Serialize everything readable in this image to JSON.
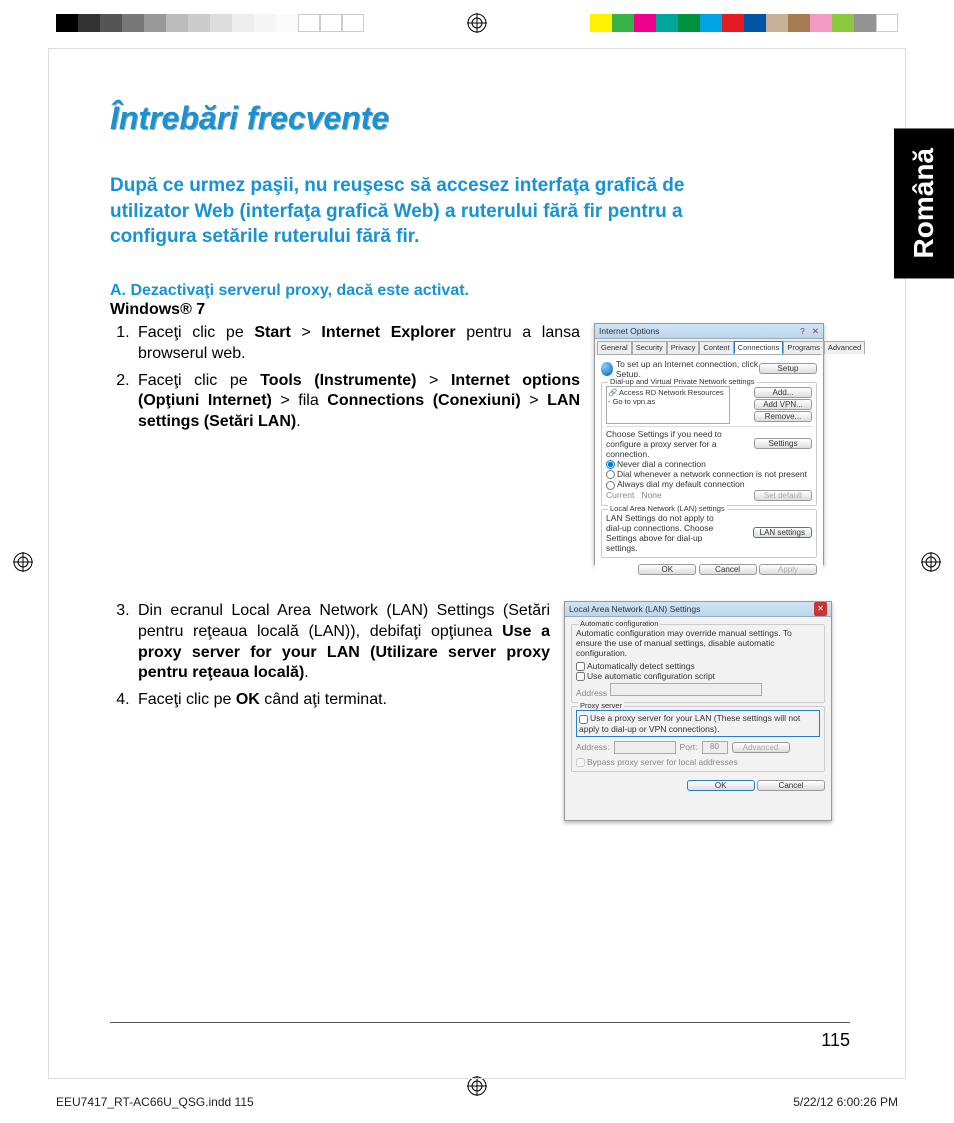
{
  "language_tab": "Română",
  "title": "Întrebări frecvente",
  "question": "După ce urmez paşii, nu reuşesc să accesez interfaţa grafică de utilizator Web (interfaţa grafică Web) a ruterului fără fir pentru a configura setările ruterului fără fir.",
  "sectionA": "A. Dezactivaţi serverul proxy, dacă este activat.",
  "os": "Windows® 7",
  "step1_pre": "Faceţi clic pe ",
  "step1_b1": "Start",
  "step1_mid": " > ",
  "step1_b2": "Internet Explorer",
  "step1_post": " pentru a lansa browserul web.",
  "step2_pre": "Faceţi clic pe ",
  "step2_b1": "Tools (Instrumente)",
  "step2_mid1": " > ",
  "step2_b2": "Internet options (Opţiuni Internet)",
  "step2_mid2": " > fila ",
  "step2_b3": "Connections (Conexiuni)",
  "step2_mid3": " > ",
  "step2_b4": "LAN settings (Setări LAN)",
  "step2_post": ".",
  "step3_pre": "Din ecranul Local Area Network (LAN) Settings (Setări pentru reţeaua locală (LAN)), debifaţi opţiunea ",
  "step3_b1": "Use a proxy server for your LAN (Utilizare server proxy pentru reţeaua locală)",
  "step3_post": ".",
  "step4_pre": "Faceţi clic pe ",
  "step4_b1": "OK",
  "step4_post": " când aţi terminat.",
  "fig1": {
    "title": "Internet Options",
    "tabs": [
      "General",
      "Security",
      "Privacy",
      "Content",
      "Connections",
      "Programs",
      "Advanced"
    ],
    "activeTab": "Connections",
    "setupText": "To set up an Internet connection, click Setup.",
    "setupBtn": "Setup",
    "dialGroup": "Dial-up and Virtual Private Network settings",
    "dialItem": "Access RD Network Resources - Go to vpn.as",
    "addBtn": "Add...",
    "addVpnBtn": "Add VPN...",
    "removeBtn": "Remove...",
    "chooseText": "Choose Settings if you need to configure a proxy server for a connection.",
    "settingsBtn": "Settings",
    "r1": "Never dial a connection",
    "r2": "Dial whenever a network connection is not present",
    "r3": "Always dial my default connection",
    "current": "Current",
    "none": "None",
    "setDefault": "Set default",
    "lanGroup": "Local Area Network (LAN) settings",
    "lanText": "LAN Settings do not apply to dial-up connections. Choose Settings above for dial-up settings.",
    "lanBtn": "LAN settings",
    "ok": "OK",
    "cancel": "Cancel",
    "apply": "Apply"
  },
  "fig2": {
    "title": "Local Area Network (LAN) Settings",
    "autoGroup": "Automatic configuration",
    "autoText": "Automatic configuration may override manual settings. To ensure the use of manual settings, disable automatic configuration.",
    "c1": "Automatically detect settings",
    "c2": "Use automatic configuration script",
    "addressLbl": "Address",
    "proxyGroup": "Proxy server",
    "proxyCb": "Use a proxy server for your LAN (These settings will not apply to dial-up or VPN connections).",
    "addr2": "Address:",
    "port": "Port:",
    "portVal": "80",
    "advanced": "Advanced",
    "bypass": "Bypass proxy server for local addresses",
    "ok": "OK",
    "cancel": "Cancel"
  },
  "page_number": "115",
  "footer_file": "EEU7417_RT-AC66U_QSG.indd   115",
  "footer_date": "5/22/12   6:00:26 PM"
}
